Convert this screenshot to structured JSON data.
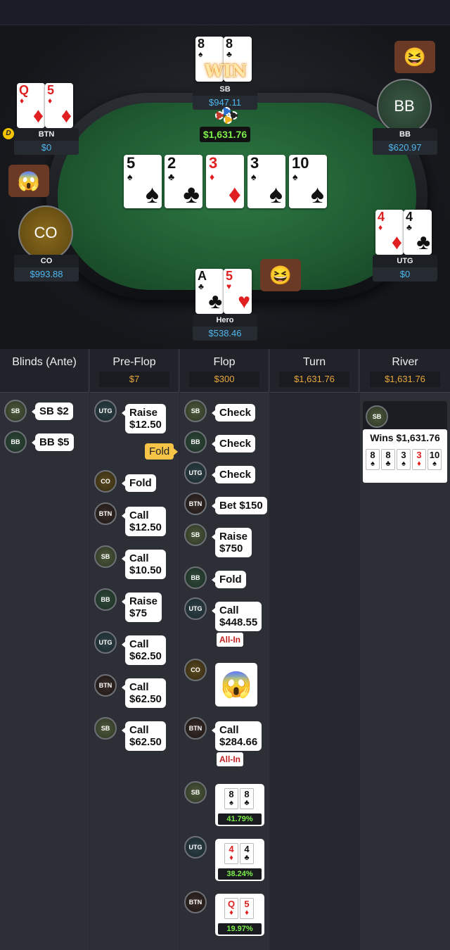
{
  "table": {
    "pot": "$1,631.76",
    "win_text": "WIN",
    "dealer_button": "D",
    "board": [
      {
        "rank": "5",
        "suit": "♠",
        "color": "#111"
      },
      {
        "rank": "2",
        "suit": "♣",
        "color": "#111"
      },
      {
        "rank": "3",
        "suit": "♦",
        "color": "#e02020"
      },
      {
        "rank": "3",
        "suit": "♠",
        "color": "#111"
      },
      {
        "rank": "10",
        "suit": "♠",
        "color": "#111"
      }
    ],
    "seats": {
      "sb": {
        "name": "SB",
        "stack": "$947.11",
        "cards": [
          {
            "rank": "8",
            "suit": "♠"
          },
          {
            "rank": "8",
            "suit": "♣"
          }
        ]
      },
      "btn": {
        "name": "BTN",
        "stack": "$0",
        "cards": [
          {
            "rank": "Q",
            "suit": "♦"
          },
          {
            "rank": "5",
            "suit": "♦"
          }
        ]
      },
      "bb": {
        "name": "BB",
        "stack": "$620.97",
        "avatar": "BB"
      },
      "co": {
        "name": "CO",
        "stack": "$993.88",
        "avatar": "CO"
      },
      "utg": {
        "name": "UTG",
        "stack": "$0",
        "cards": [
          {
            "rank": "4",
            "suit": "♦"
          },
          {
            "rank": "4",
            "suit": "♣"
          }
        ]
      },
      "hero": {
        "name": "Hero",
        "stack": "$538.46",
        "cards": [
          {
            "rank": "A",
            "suit": "♣"
          },
          {
            "rank": "5",
            "suit": "♥"
          }
        ]
      }
    }
  },
  "history": {
    "columns": [
      {
        "title": "Blinds (Ante)",
        "pot": ""
      },
      {
        "title": "Pre-Flop",
        "pot": "$7"
      },
      {
        "title": "Flop",
        "pot": "$300"
      },
      {
        "title": "Turn",
        "pot": "$1,631.76"
      },
      {
        "title": "River",
        "pot": "$1,631.76"
      }
    ],
    "blinds": [
      {
        "pos": "SB",
        "line1": "SB $2"
      },
      {
        "pos": "BB",
        "line1": "BB $5"
      }
    ],
    "preflop": [
      {
        "pos": "UTG",
        "line1": "Raise",
        "line2": "$12.50"
      },
      {
        "pos": "CO",
        "line1": "Fold"
      },
      {
        "pos": "BTN",
        "line1": "Call",
        "line2": "$12.50"
      },
      {
        "pos": "SB",
        "line1": "Call",
        "line2": "$10.50"
      },
      {
        "pos": "BB",
        "line1": "Raise",
        "line2": "$75"
      },
      {
        "pos": "UTG",
        "line1": "Call",
        "line2": "$62.50"
      },
      {
        "pos": "BTN",
        "line1": "Call",
        "line2": "$62.50"
      },
      {
        "pos": "SB",
        "line1": "Call",
        "line2": "$62.50"
      }
    ],
    "preflop_fold_tag": "Fold",
    "flop": [
      {
        "pos": "SB",
        "line1": "Check"
      },
      {
        "pos": "BB",
        "line1": "Check"
      },
      {
        "pos": "UTG",
        "line1": "Check"
      },
      {
        "pos": "BTN",
        "line1": "Bet $150"
      },
      {
        "pos": "SB",
        "line1": "Raise",
        "line2": "$750"
      },
      {
        "pos": "BB",
        "line1": "Fold"
      },
      {
        "pos": "UTG",
        "line1": "Call",
        "line2": "$448.55",
        "tag": "All-In"
      },
      {
        "pos": "CO",
        "emote": "scared-face"
      },
      {
        "pos": "BTN",
        "line1": "Call",
        "line2": "$284.66",
        "tag": "All-In"
      }
    ],
    "showdown": [
      {
        "pos": "SB",
        "cards": [
          {
            "rank": "8",
            "suit": "♠"
          },
          {
            "rank": "8",
            "suit": "♣"
          }
        ],
        "equity": "41.79%"
      },
      {
        "pos": "UTG",
        "cards": [
          {
            "rank": "4",
            "suit": "♦"
          },
          {
            "rank": "4",
            "suit": "♣"
          }
        ],
        "equity": "38.24%"
      },
      {
        "pos": "BTN",
        "cards": [
          {
            "rank": "Q",
            "suit": "♦"
          },
          {
            "rank": "5",
            "suit": "♦"
          }
        ],
        "equity": "19.97%"
      }
    ],
    "river": {
      "pos": "SB",
      "result": "Wins $1,631.76",
      "cards": [
        {
          "rank": "8",
          "suit": "♠"
        },
        {
          "rank": "8",
          "suit": "♣"
        },
        {
          "rank": "3",
          "suit": "♠"
        },
        {
          "rank": "3",
          "suit": "♦"
        },
        {
          "rank": "10",
          "suit": "♠"
        }
      ]
    }
  }
}
